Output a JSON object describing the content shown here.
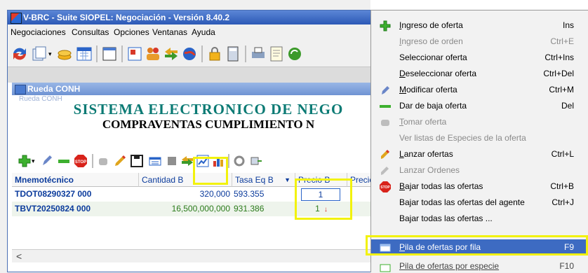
{
  "window": {
    "title": "V-BRC - Suite SIOPEL: Negociación - Versión 8.40.2"
  },
  "menubar": [
    {
      "label": "Negociaciones"
    },
    {
      "label": "Consultas"
    },
    {
      "label": "Opciones"
    },
    {
      "label": "Ventanas"
    },
    {
      "label": "Ayuda"
    }
  ],
  "child": {
    "title": "Rueda CONH",
    "ghost_title": "Rueda CONH",
    "heading1": "SISTEMA ELECTRONICO DE NEGO",
    "heading2": "COMPRAVENTAS CUMPLIMIENTO N"
  },
  "grid": {
    "columns": [
      "Mnemotécnico",
      "Cantidad B",
      "Tasa Eq B",
      "Precio B",
      "Precio"
    ],
    "rows": [
      {
        "mnemo": "TDOT08290327 000",
        "cantidad": "320,000",
        "tasa": "593.355",
        "precio": "1"
      },
      {
        "mnemo": "TBVT20250824 000",
        "cantidad": "16,500,000,000",
        "tasa": "931.386",
        "precio": "1"
      }
    ],
    "scroll_left": "<"
  },
  "context_menu": {
    "items": [
      {
        "label": "Ingreso de oferta",
        "u": "I",
        "rest": "ngreso de oferta",
        "shortcut": "Ins",
        "enabled": true,
        "icon": "plus-icon"
      },
      {
        "label": "Ingreso de orden",
        "u": "I",
        "rest": "ngreso de orden",
        "shortcut": "Ctrl+E",
        "enabled": false,
        "icon": ""
      },
      {
        "label": "Seleccionar oferta",
        "u": "",
        "rest": "Seleccionar oferta",
        "shortcut": "Ctrl+Ins",
        "enabled": true,
        "icon": ""
      },
      {
        "label": "Deseleccionar oferta",
        "u": "D",
        "rest": "eseleccionar oferta",
        "shortcut": "Ctrl+Del",
        "enabled": true,
        "icon": ""
      },
      {
        "label": "Modificar oferta",
        "u": "M",
        "rest": "odificar oferta",
        "shortcut": "Ctrl+M",
        "enabled": true,
        "icon": "pen-icon"
      },
      {
        "label": "Dar de baja oferta",
        "u": "",
        "rest": "Dar de baja oferta",
        "shortcut": "Del",
        "enabled": true,
        "icon": "minus-icon"
      },
      {
        "label": "Tomar oferta",
        "u": "T",
        "rest": "omar oferta",
        "shortcut": "",
        "enabled": false,
        "icon": "hand-icon"
      },
      {
        "label": "Ver listas de Especies de la oferta",
        "u": "",
        "rest": "Ver listas de Especies de la oferta",
        "shortcut": "",
        "enabled": false,
        "icon": ""
      },
      {
        "label": "Lanzar ofertas",
        "u": "L",
        "rest": "anzar ofertas",
        "shortcut": "Ctrl+L",
        "enabled": true,
        "icon": "launch-icon"
      },
      {
        "label": "Lanzar Ordenes",
        "u": "",
        "rest": "Lanzar Ordenes",
        "shortcut": "",
        "enabled": false,
        "icon": "launch-icon"
      },
      {
        "label": "Bajar todas las ofertas",
        "u": "B",
        "rest": "ajar todas las ofertas",
        "shortcut": "Ctrl+B",
        "enabled": true,
        "icon": "stop-icon"
      },
      {
        "label": "Bajar todas las ofertas del agente",
        "u": "",
        "rest": "Bajar todas las ofertas del agente",
        "shortcut": "Ctrl+J",
        "enabled": true,
        "icon": ""
      },
      {
        "label": "Bajar todas las ofertas ...",
        "u": "",
        "rest": "Bajar todas las ofertas ...",
        "shortcut": "",
        "enabled": true,
        "icon": ""
      }
    ],
    "selected": {
      "label": "Pila de ofertas por fila",
      "u": "P",
      "rest": "ila de ofertas por fila",
      "shortcut": "F9",
      "icon": "stack-icon"
    },
    "partial": {
      "label": "Pila de ofertas por especie",
      "shortcut": "F10"
    },
    "stop_text": "STOP"
  },
  "colors": {
    "title_blue": "#2c59b6",
    "highlight_yellow": "#f2f20c",
    "menu_selected": "#3d6bc2",
    "heading_teal": "#0b7a74",
    "mnemo_blue": "#0b3b9c"
  }
}
